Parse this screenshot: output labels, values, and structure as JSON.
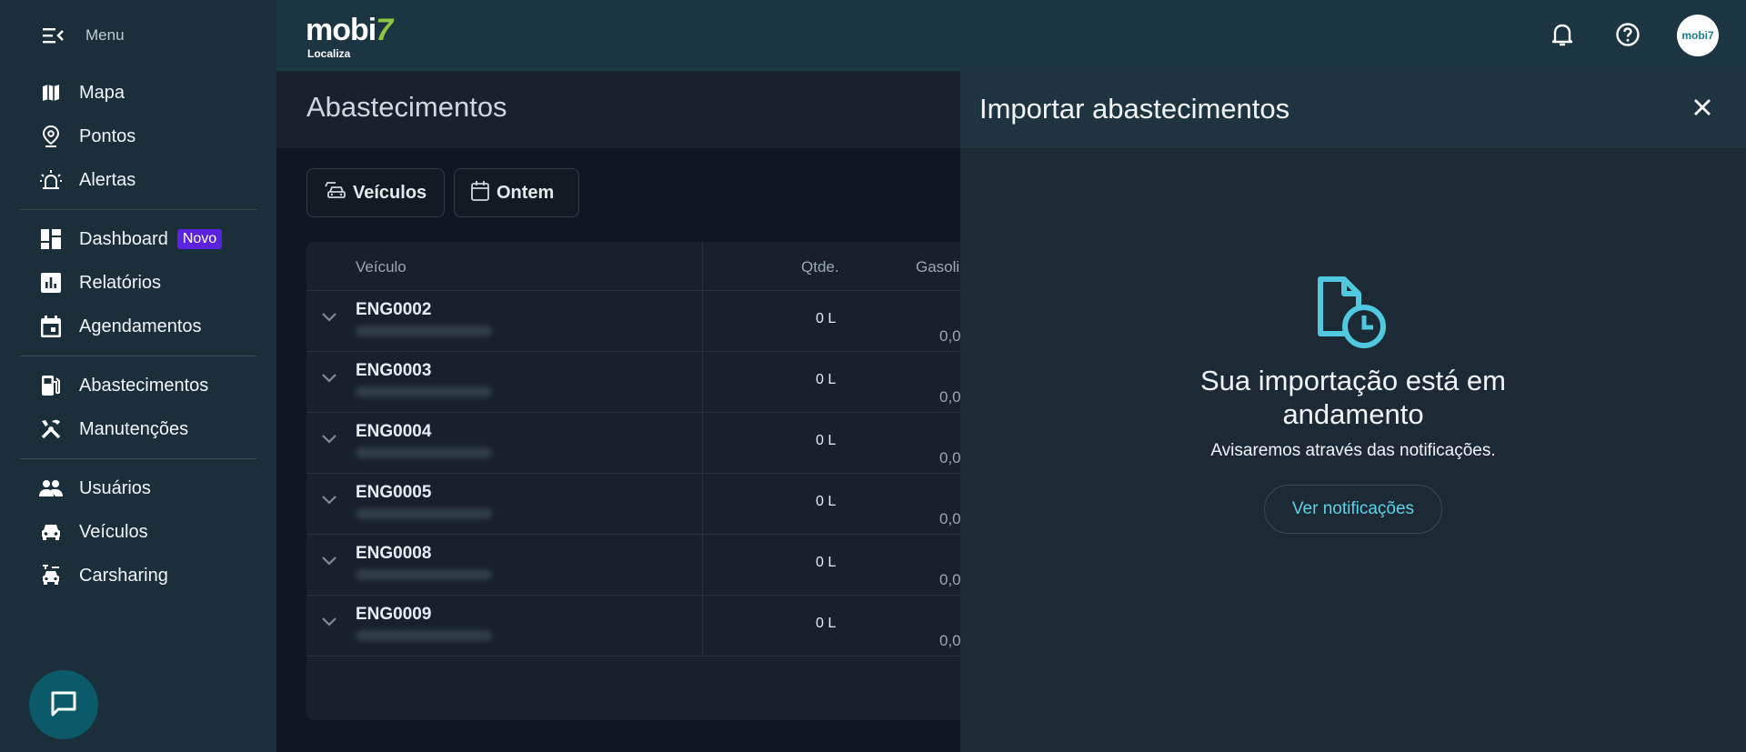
{
  "sidebar": {
    "menu_label": "Menu",
    "groups": [
      [
        {
          "label": "Mapa",
          "icon": "map-icon"
        },
        {
          "label": "Pontos",
          "icon": "location-pin-icon"
        },
        {
          "label": "Alertas",
          "icon": "siren-icon"
        }
      ],
      [
        {
          "label": "Dashboard",
          "icon": "dashboard-icon",
          "badge": "Novo"
        },
        {
          "label": "Relatórios",
          "icon": "report-chart-icon"
        },
        {
          "label": "Agendamentos",
          "icon": "calendar-icon"
        }
      ],
      [
        {
          "label": "Abastecimentos",
          "icon": "fuel-pump-icon"
        },
        {
          "label": "Manutenções",
          "icon": "tools-icon"
        }
      ],
      [
        {
          "label": "Usuários",
          "icon": "users-icon"
        },
        {
          "label": "Veículos",
          "icon": "car-icon"
        },
        {
          "label": "Carsharing",
          "icon": "carsharing-icon"
        }
      ]
    ]
  },
  "header": {
    "logo_word": "mobi",
    "logo_seven": "7",
    "logo_sub": "Localiza",
    "avatar_text": "mobi7"
  },
  "page": {
    "title": "Abastecimentos",
    "filters": {
      "vehicles": "Veículos",
      "date": "Ontem"
    },
    "table": {
      "columns": {
        "vehicle": "Veículo",
        "qty": "Qtde.",
        "gas": "Gasoli"
      },
      "rows": [
        {
          "id": "ENG0002",
          "qty": "0 L",
          "gas": "0,0"
        },
        {
          "id": "ENG0003",
          "qty": "0 L",
          "gas": "0,0"
        },
        {
          "id": "ENG0004",
          "qty": "0 L",
          "gas": "0,0"
        },
        {
          "id": "ENG0005",
          "qty": "0 L",
          "gas": "0,0"
        },
        {
          "id": "ENG0008",
          "qty": "0 L",
          "gas": "0,0"
        },
        {
          "id": "ENG0009",
          "qty": "0 L",
          "gas": "0,0"
        }
      ]
    }
  },
  "drawer": {
    "title": "Importar abastecimentos",
    "message_title": "Sua importação está em andamento",
    "message_sub": "Avisaremos através das notificações.",
    "button": "Ver notificações"
  },
  "colors": {
    "accent": "#5ed1e6",
    "badge": "#5b22e0",
    "sidebar_bg": "#1a2f3a"
  }
}
